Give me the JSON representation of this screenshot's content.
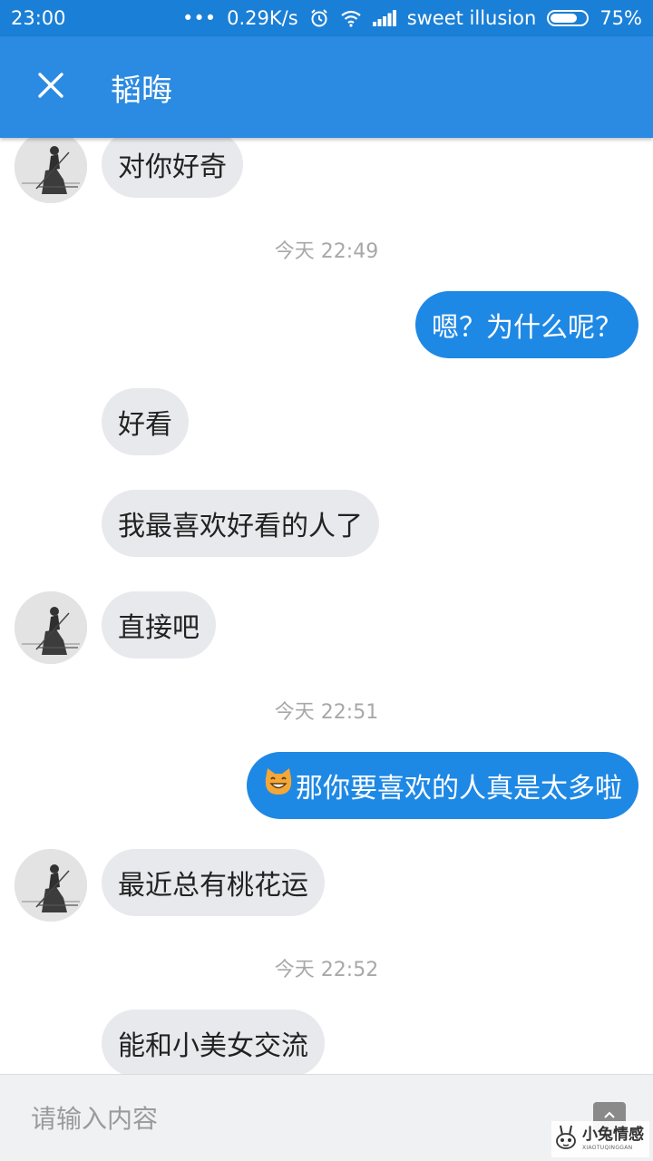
{
  "status_bar": {
    "time": "23:00",
    "dots": "•••",
    "net_speed": "0.29K/s",
    "alarm_icon": "alarm-clock-icon",
    "wifi_icon": "wifi-icon",
    "signal_icon": "signal-icon",
    "carrier": "sweet illusion",
    "battery_percent": "75%",
    "battery_level": 0.75
  },
  "app_bar": {
    "close_icon": "close-icon",
    "title": "韬晦"
  },
  "messages": [
    {
      "type": "incoming",
      "text": "对你好奇",
      "avatar": true
    },
    {
      "type": "timestamp",
      "text": "今天 22:49"
    },
    {
      "type": "outgoing",
      "text": "嗯？为什么呢？"
    },
    {
      "type": "incoming",
      "text": "好看",
      "avatar": false
    },
    {
      "type": "incoming",
      "text": "我最喜欢好看的人了",
      "avatar": false
    },
    {
      "type": "incoming",
      "text": "直接吧",
      "avatar": true
    },
    {
      "type": "timestamp",
      "text": "今天 22:51"
    },
    {
      "type": "outgoing",
      "text": "那你要喜欢的人真是太多啦",
      "emoji": "grinning-cat-emoji"
    },
    {
      "type": "incoming",
      "text": "最近总有桃花运",
      "avatar": true
    },
    {
      "type": "timestamp",
      "text": "今天 22:52"
    },
    {
      "type": "incoming",
      "text": "能和小美女交流",
      "avatar": false
    }
  ],
  "input_bar": {
    "placeholder": "请输入内容",
    "send_icon": "send-icon"
  },
  "watermark": {
    "text": "小兔情感",
    "subtext": "XIAOTUQINGGAN"
  },
  "colors": {
    "status_bar": "#1a7fd6",
    "app_bar": "#2b8ae2",
    "outgoing_bubble": "#1e88e5",
    "incoming_bubble": "#e8e9ed",
    "timestamp": "#a8a8a8"
  }
}
